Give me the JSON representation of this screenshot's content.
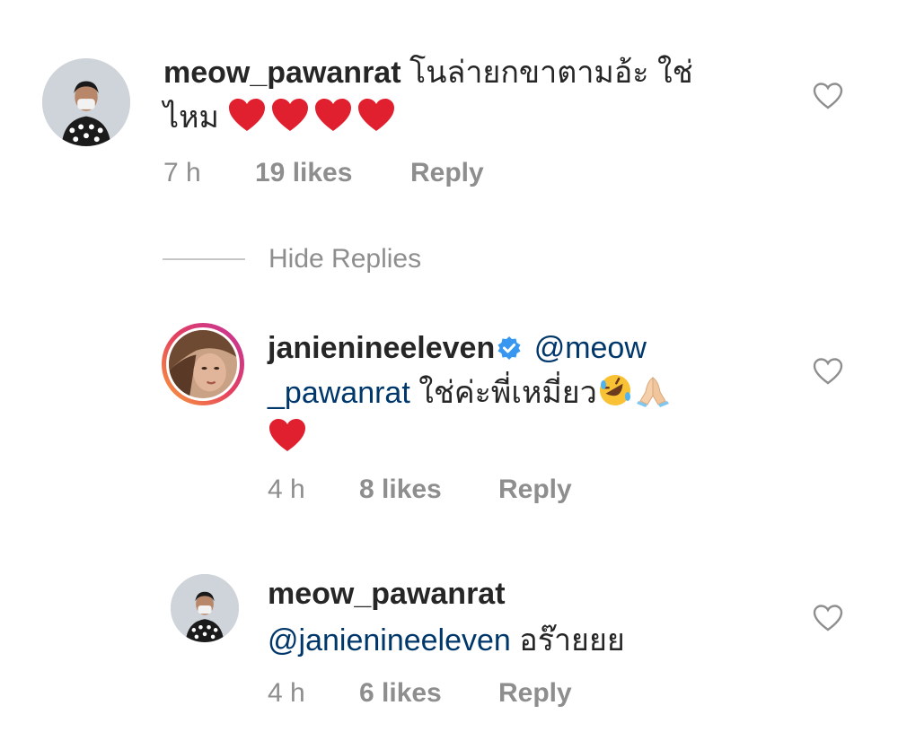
{
  "comments": [
    {
      "username": "meow_pawanrat",
      "line1": "โนล่ายกขาตามอ้ะ ใช่",
      "line2": "ไหม",
      "hearts": 4,
      "time": "7 h",
      "likes": "19 likes",
      "reply": "Reply"
    }
  ],
  "hide_replies_label": "Hide Replies",
  "replies": [
    {
      "username": "janienineeleven",
      "verified": true,
      "mention_part1": "@meow",
      "mention_part2": "_pawanrat",
      "body": "ใช่ค่ะพี่เหมี่ยว",
      "time": "4 h",
      "likes": "8 likes",
      "reply": "Reply"
    },
    {
      "username": "meow_pawanrat",
      "mention": "@janienineeleven",
      "body": "อร๊ายยย",
      "time": "4 h",
      "likes": "6 likes",
      "reply": "Reply"
    }
  ],
  "icons": {
    "like": "heart-outline-icon",
    "verified": "verified-badge-icon",
    "heart_emoji": "red-heart-emoji",
    "laugh_emoji": "rolling-laughing-emoji",
    "pray_emoji": "folded-hands-emoji"
  },
  "colors": {
    "mention": "#00376b",
    "secondary": "#8e8e8e",
    "verified": "#3897f0",
    "heart": "#e0202e"
  }
}
